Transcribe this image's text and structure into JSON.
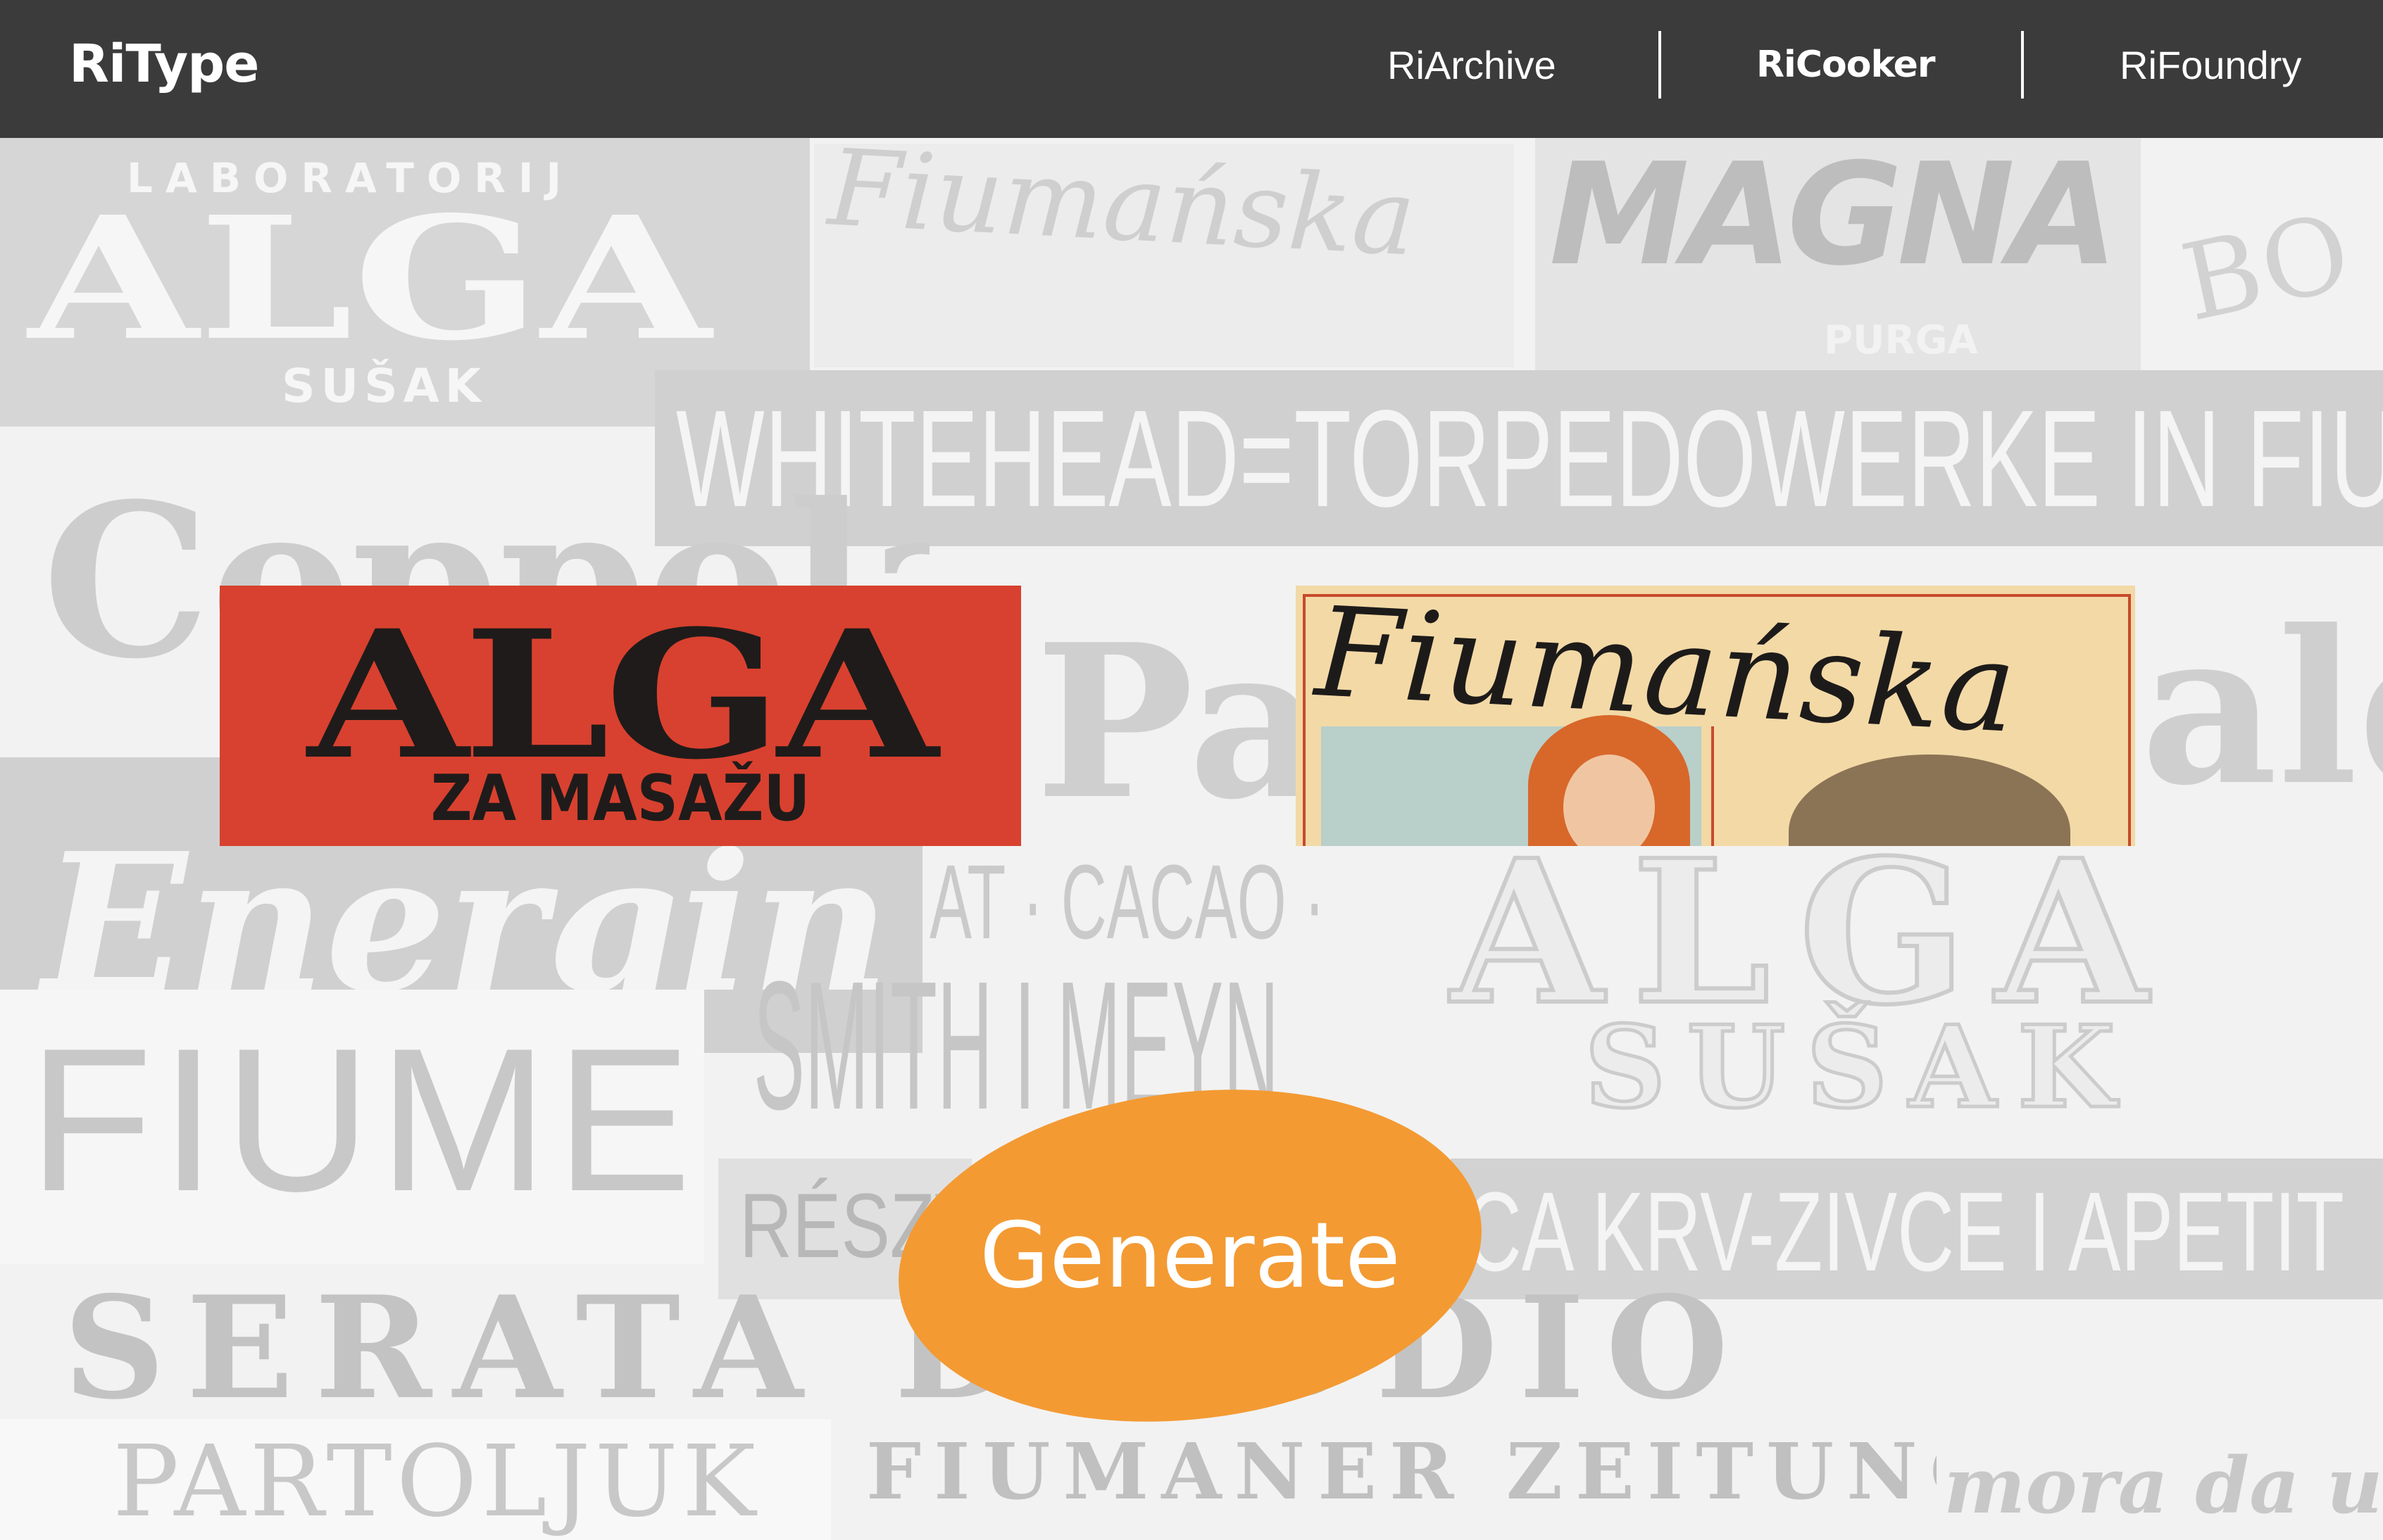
{
  "nav": {
    "logo": "RiType",
    "links": [
      "RiArchive",
      "RiCooker",
      "RiFoundry"
    ],
    "active_index": 1
  },
  "collage": [
    "LABORATORIJ",
    "ALGA",
    "SUŠAK",
    "Fiumańska",
    "MAGNA",
    "PURGA",
    "BO",
    "WHITEHEAD=TORPEDOWERKE IN FIUM",
    "Coppola",
    "Pat",
    "aldi",
    "Energin",
    "AT · CACAO ·",
    "SMITH I MEYN",
    "ALGA",
    "SUŠAK",
    "FIUME",
    "RÉSZV",
    "CA KRV-ZIVCE I APETIT",
    "SERATA D'ADDIO",
    "PARTOLJUK",
    "FIUMANER ZEITUNG",
    "mora da u"
  ],
  "posters": {
    "alga": {
      "title": "ALGA",
      "subtitle": "ZA MASAŽU"
    },
    "fiumanska": {
      "title": "Fiumańska"
    }
  },
  "action": {
    "generate_label": "Generate"
  },
  "colors": {
    "navbar": "#3b3b3b",
    "accent": "#f39a33",
    "alga_poster": "#d8412f",
    "fiumanska_poster": "#f3d9a6",
    "collage_text": "#c9c9c9"
  }
}
